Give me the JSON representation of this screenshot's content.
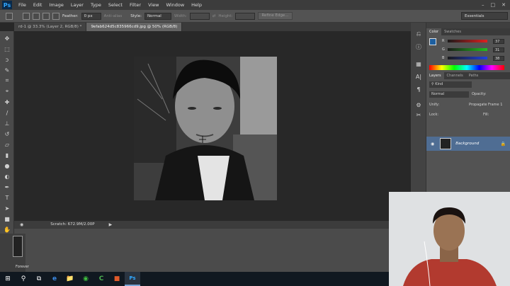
{
  "app": {
    "logo": "Ps"
  },
  "menu": [
    "File",
    "Edit",
    "Image",
    "Layer",
    "Type",
    "Select",
    "Filter",
    "View",
    "Window",
    "Help"
  ],
  "window_controls": [
    "–",
    "□",
    "✕"
  ],
  "options": {
    "feather_label": "Feather:",
    "feather_value": "0 px",
    "antialias_label": "Anti-alias",
    "style_label": "Style:",
    "style_value": "Normal",
    "width_label": "Width:",
    "height_label": "Height:",
    "refine_label": "Refine Edge...",
    "workspace": "Essentials"
  },
  "tabs": [
    {
      "label": "rd-1 @ 33.3% (Layer 2, RGB/8) *",
      "active": false
    },
    {
      "label": "9efab624d5c835966cd9.jpg @ 50% (RGB/8)",
      "active": true
    }
  ],
  "status": {
    "scratch": "Scratch: 672.9M/2.00P"
  },
  "timeline": {
    "loop": "Forever"
  },
  "color_panel": {
    "tabs": [
      "Color",
      "Swatches"
    ],
    "channels": [
      {
        "label": "R",
        "value": "37",
        "color": "#e02020"
      },
      {
        "label": "G",
        "value": "31",
        "color": "#20c020"
      },
      {
        "label": "B",
        "value": "38",
        "color": "#2040e0"
      }
    ]
  },
  "layers_panel": {
    "tabs": [
      "Layers",
      "Channels",
      "Paths"
    ],
    "kind": "Kind",
    "blend_mode": "Normal",
    "opacity_label": "Opacity:",
    "unify_label": "Unify:",
    "propagate_label": "Propagate Frame 1",
    "lock_label": "Lock:",
    "fill_label": "Fill:",
    "layer_name": "Background"
  },
  "taskbar": [
    "⊞",
    "⚲",
    "⧉",
    "e",
    "📁",
    "◉",
    "C",
    "■",
    "Ps"
  ],
  "colors": {
    "accent": "#31a8ff",
    "foreground_swatch": "#1d5fa0"
  }
}
